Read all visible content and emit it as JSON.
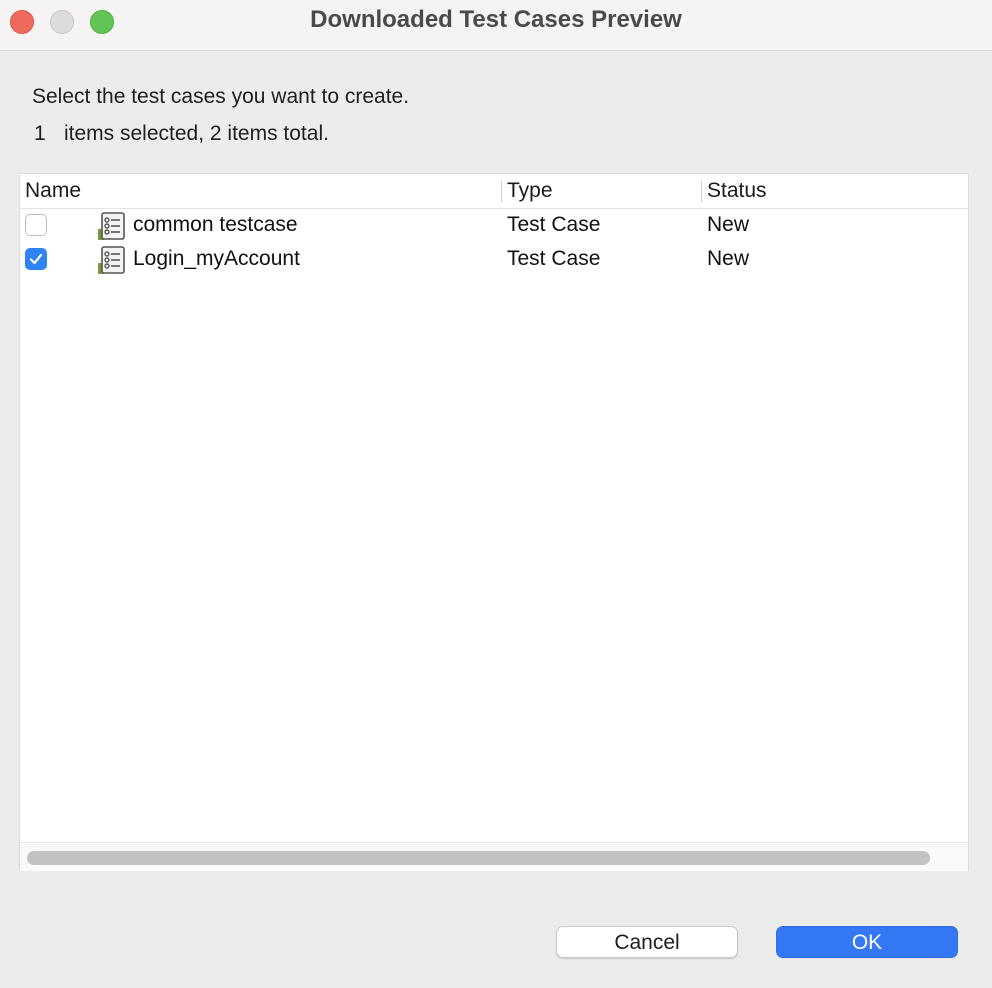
{
  "window": {
    "title": "Downloaded Test Cases Preview"
  },
  "dialog": {
    "prompt": "Select the test cases you want to create.",
    "selected_count": "1",
    "selection_summary": "items selected, 2 items total."
  },
  "table": {
    "columns": [
      "Name",
      "Type",
      "Status"
    ],
    "rows": [
      {
        "checked": false,
        "name": "common testcase",
        "type": "Test Case",
        "status": "New",
        "icon": "test-case-icon"
      },
      {
        "checked": true,
        "name": "Login_myAccount",
        "type": "Test Case",
        "status": "New",
        "icon": "test-case-icon"
      }
    ]
  },
  "buttons": {
    "cancel": "Cancel",
    "ok": "OK"
  },
  "colors": {
    "accent": "#3478f6",
    "close": "#ee6a5f",
    "maximize": "#61c454"
  }
}
